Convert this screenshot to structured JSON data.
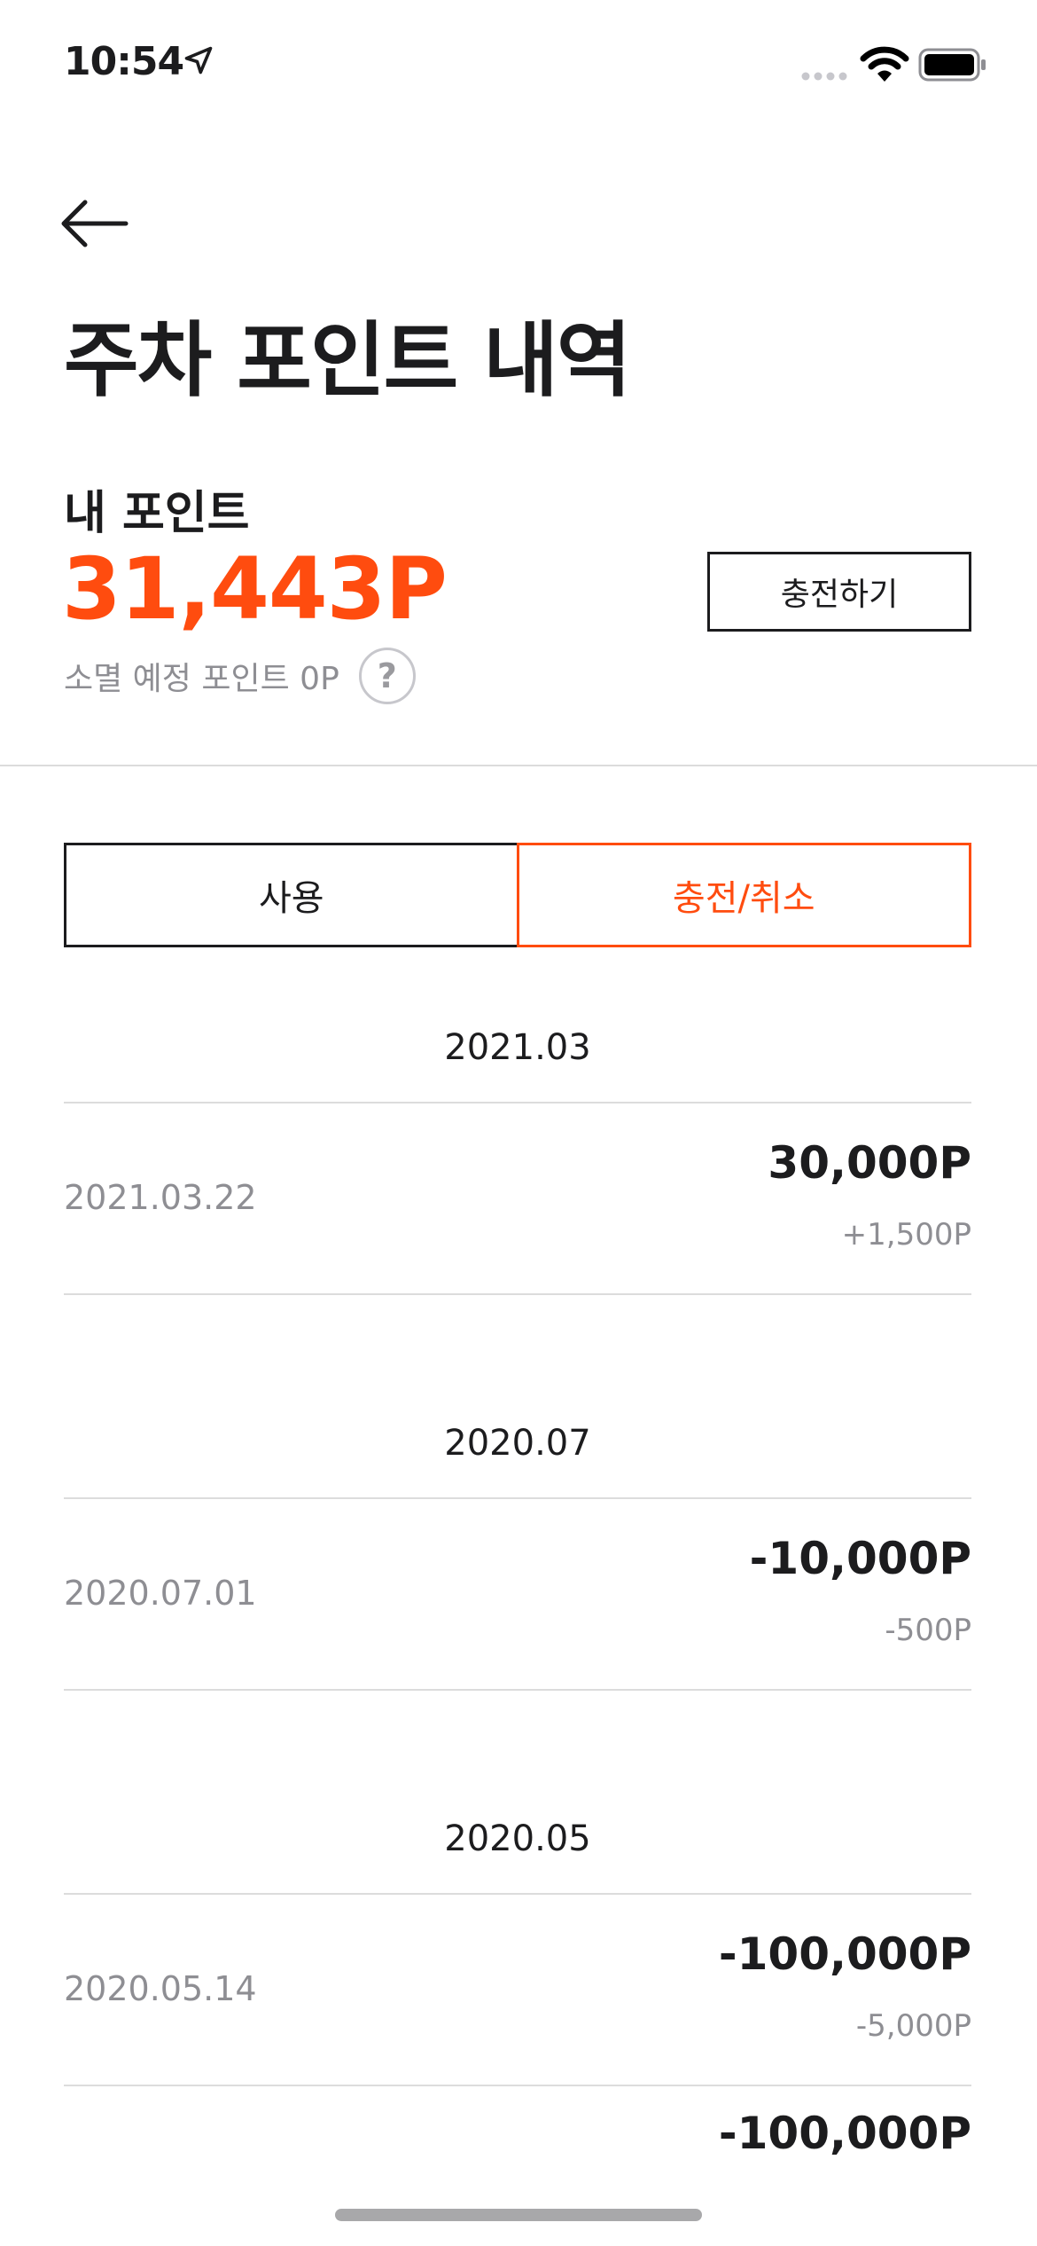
{
  "status_bar": {
    "time": "10:54"
  },
  "header": {
    "title": "주차 포인트 내역"
  },
  "points": {
    "label": "내 포인트",
    "value": "31,443P",
    "expire_text": "소멸 예정 포인트 0P",
    "help_symbol": "?",
    "charge_button": "충전하기"
  },
  "tabs": [
    {
      "label": "사용",
      "active": false
    },
    {
      "label": "충전/취소",
      "active": true
    }
  ],
  "history": [
    {
      "month": "2021.03",
      "entries": [
        {
          "date": "2021.03.22",
          "amount": "30,000P",
          "bonus": "+1,500P"
        }
      ]
    },
    {
      "month": "2020.07",
      "entries": [
        {
          "date": "2020.07.01",
          "amount": "-10,000P",
          "bonus": "-500P"
        }
      ]
    },
    {
      "month": "2020.05",
      "entries": [
        {
          "date": "2020.05.14",
          "amount": "-100,000P",
          "bonus": "-5,000P"
        }
      ]
    }
  ],
  "partial_next_amount": "-100,000P",
  "colors": {
    "accent": "#ff4c0f",
    "text": "#1c1c1e",
    "muted": "#8e8e93",
    "divider": "#dcdcdc"
  }
}
